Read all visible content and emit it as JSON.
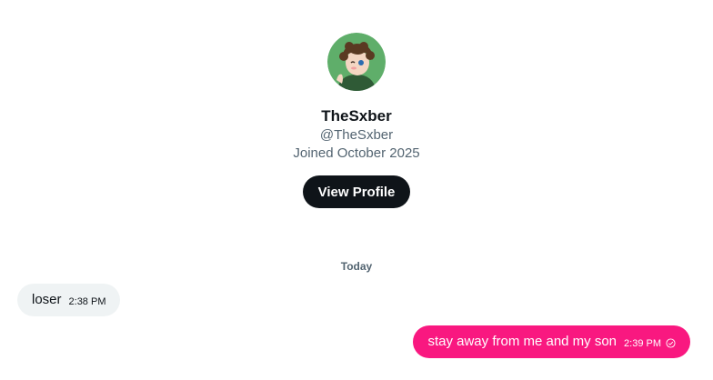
{
  "profile": {
    "display_name": "TheSxber",
    "handle": "@TheSxber",
    "joined": "Joined October 2025",
    "view_profile_label": "View Profile",
    "avatar_icon": "avatar-cartoon-character"
  },
  "conversation": {
    "day_label": "Today",
    "messages": [
      {
        "direction": "incoming",
        "text": "loser",
        "time": "2:38 PM"
      },
      {
        "direction": "outgoing",
        "text": "stay away from me and my son",
        "time": "2:39 PM",
        "status_icon": "sent-check-icon"
      }
    ]
  },
  "colors": {
    "outgoing_bubble": "#f91880",
    "incoming_bubble": "#eff3f4",
    "button": "#0f1419",
    "secondary_text": "#536471"
  }
}
